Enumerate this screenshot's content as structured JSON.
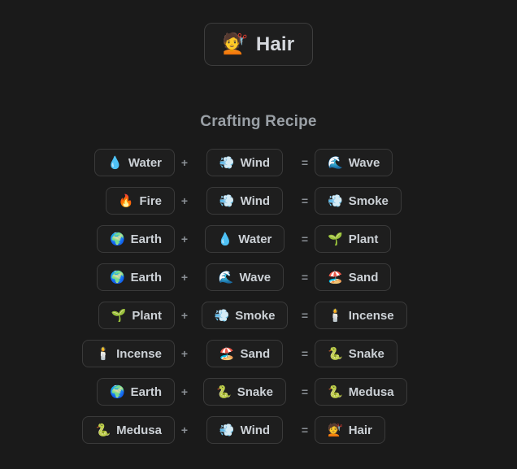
{
  "page": {
    "background_color": "#1a1a1a",
    "pill_background_color": "#1e1e1e",
    "pill_border_color": "#3a3a3a",
    "text_color": "#ccd1d6",
    "muted_text_color": "#9aa0a6"
  },
  "header": {
    "item": {
      "emoji": "💇",
      "emoji_name": "person-getting-haircut-icon",
      "label": "Hair"
    }
  },
  "section": {
    "title": "Crafting Recipe"
  },
  "operators": {
    "plus": "+",
    "equals": "="
  },
  "recipes": [
    {
      "a": {
        "emoji": "💧",
        "emoji_name": "droplet-icon",
        "label": "Water"
      },
      "plus": "+",
      "b": {
        "emoji": "💨",
        "emoji_name": "dash-wind-icon",
        "label": "Wind"
      },
      "equals": "=",
      "c": {
        "emoji": "🌊",
        "emoji_name": "wave-icon",
        "label": "Wave"
      }
    },
    {
      "a": {
        "emoji": "🔥",
        "emoji_name": "fire-icon",
        "label": "Fire"
      },
      "plus": "+",
      "b": {
        "emoji": "💨",
        "emoji_name": "dash-wind-icon",
        "label": "Wind"
      },
      "equals": "=",
      "c": {
        "emoji": "💨",
        "emoji_name": "dash-wind-icon",
        "label": "Smoke"
      }
    },
    {
      "a": {
        "emoji": "🌍",
        "emoji_name": "earth-globe-icon",
        "label": "Earth"
      },
      "plus": "+",
      "b": {
        "emoji": "💧",
        "emoji_name": "droplet-icon",
        "label": "Water"
      },
      "equals": "=",
      "c": {
        "emoji": "🌱",
        "emoji_name": "seedling-icon",
        "label": "Plant"
      }
    },
    {
      "a": {
        "emoji": "🌍",
        "emoji_name": "earth-globe-icon",
        "label": "Earth"
      },
      "plus": "+",
      "b": {
        "emoji": "🌊",
        "emoji_name": "wave-icon",
        "label": "Wave"
      },
      "equals": "=",
      "c": {
        "emoji": "🏖️",
        "emoji_name": "beach-umbrella-icon",
        "label": "Sand"
      }
    },
    {
      "a": {
        "emoji": "🌱",
        "emoji_name": "seedling-icon",
        "label": "Plant"
      },
      "plus": "+",
      "b": {
        "emoji": "💨",
        "emoji_name": "dash-wind-icon",
        "label": "Smoke"
      },
      "equals": "=",
      "c": {
        "emoji": "🕯️",
        "emoji_name": "candle-icon",
        "label": "Incense"
      }
    },
    {
      "a": {
        "emoji": "🕯️",
        "emoji_name": "candle-icon",
        "label": "Incense"
      },
      "plus": "+",
      "b": {
        "emoji": "🏖️",
        "emoji_name": "beach-umbrella-icon",
        "label": "Sand"
      },
      "equals": "=",
      "c": {
        "emoji": "🐍",
        "emoji_name": "snake-icon",
        "label": "Snake"
      }
    },
    {
      "a": {
        "emoji": "🌍",
        "emoji_name": "earth-globe-icon",
        "label": "Earth"
      },
      "plus": "+",
      "b": {
        "emoji": "🐍",
        "emoji_name": "snake-icon",
        "label": "Snake"
      },
      "equals": "=",
      "c": {
        "emoji": "🐍",
        "emoji_name": "snake-icon",
        "label": "Medusa"
      }
    },
    {
      "a": {
        "emoji": "🐍",
        "emoji_name": "snake-icon",
        "label": "Medusa"
      },
      "plus": "+",
      "b": {
        "emoji": "💨",
        "emoji_name": "dash-wind-icon",
        "label": "Wind"
      },
      "equals": "=",
      "c": {
        "emoji": "💇",
        "emoji_name": "person-getting-haircut-icon",
        "label": "Hair"
      }
    }
  ]
}
